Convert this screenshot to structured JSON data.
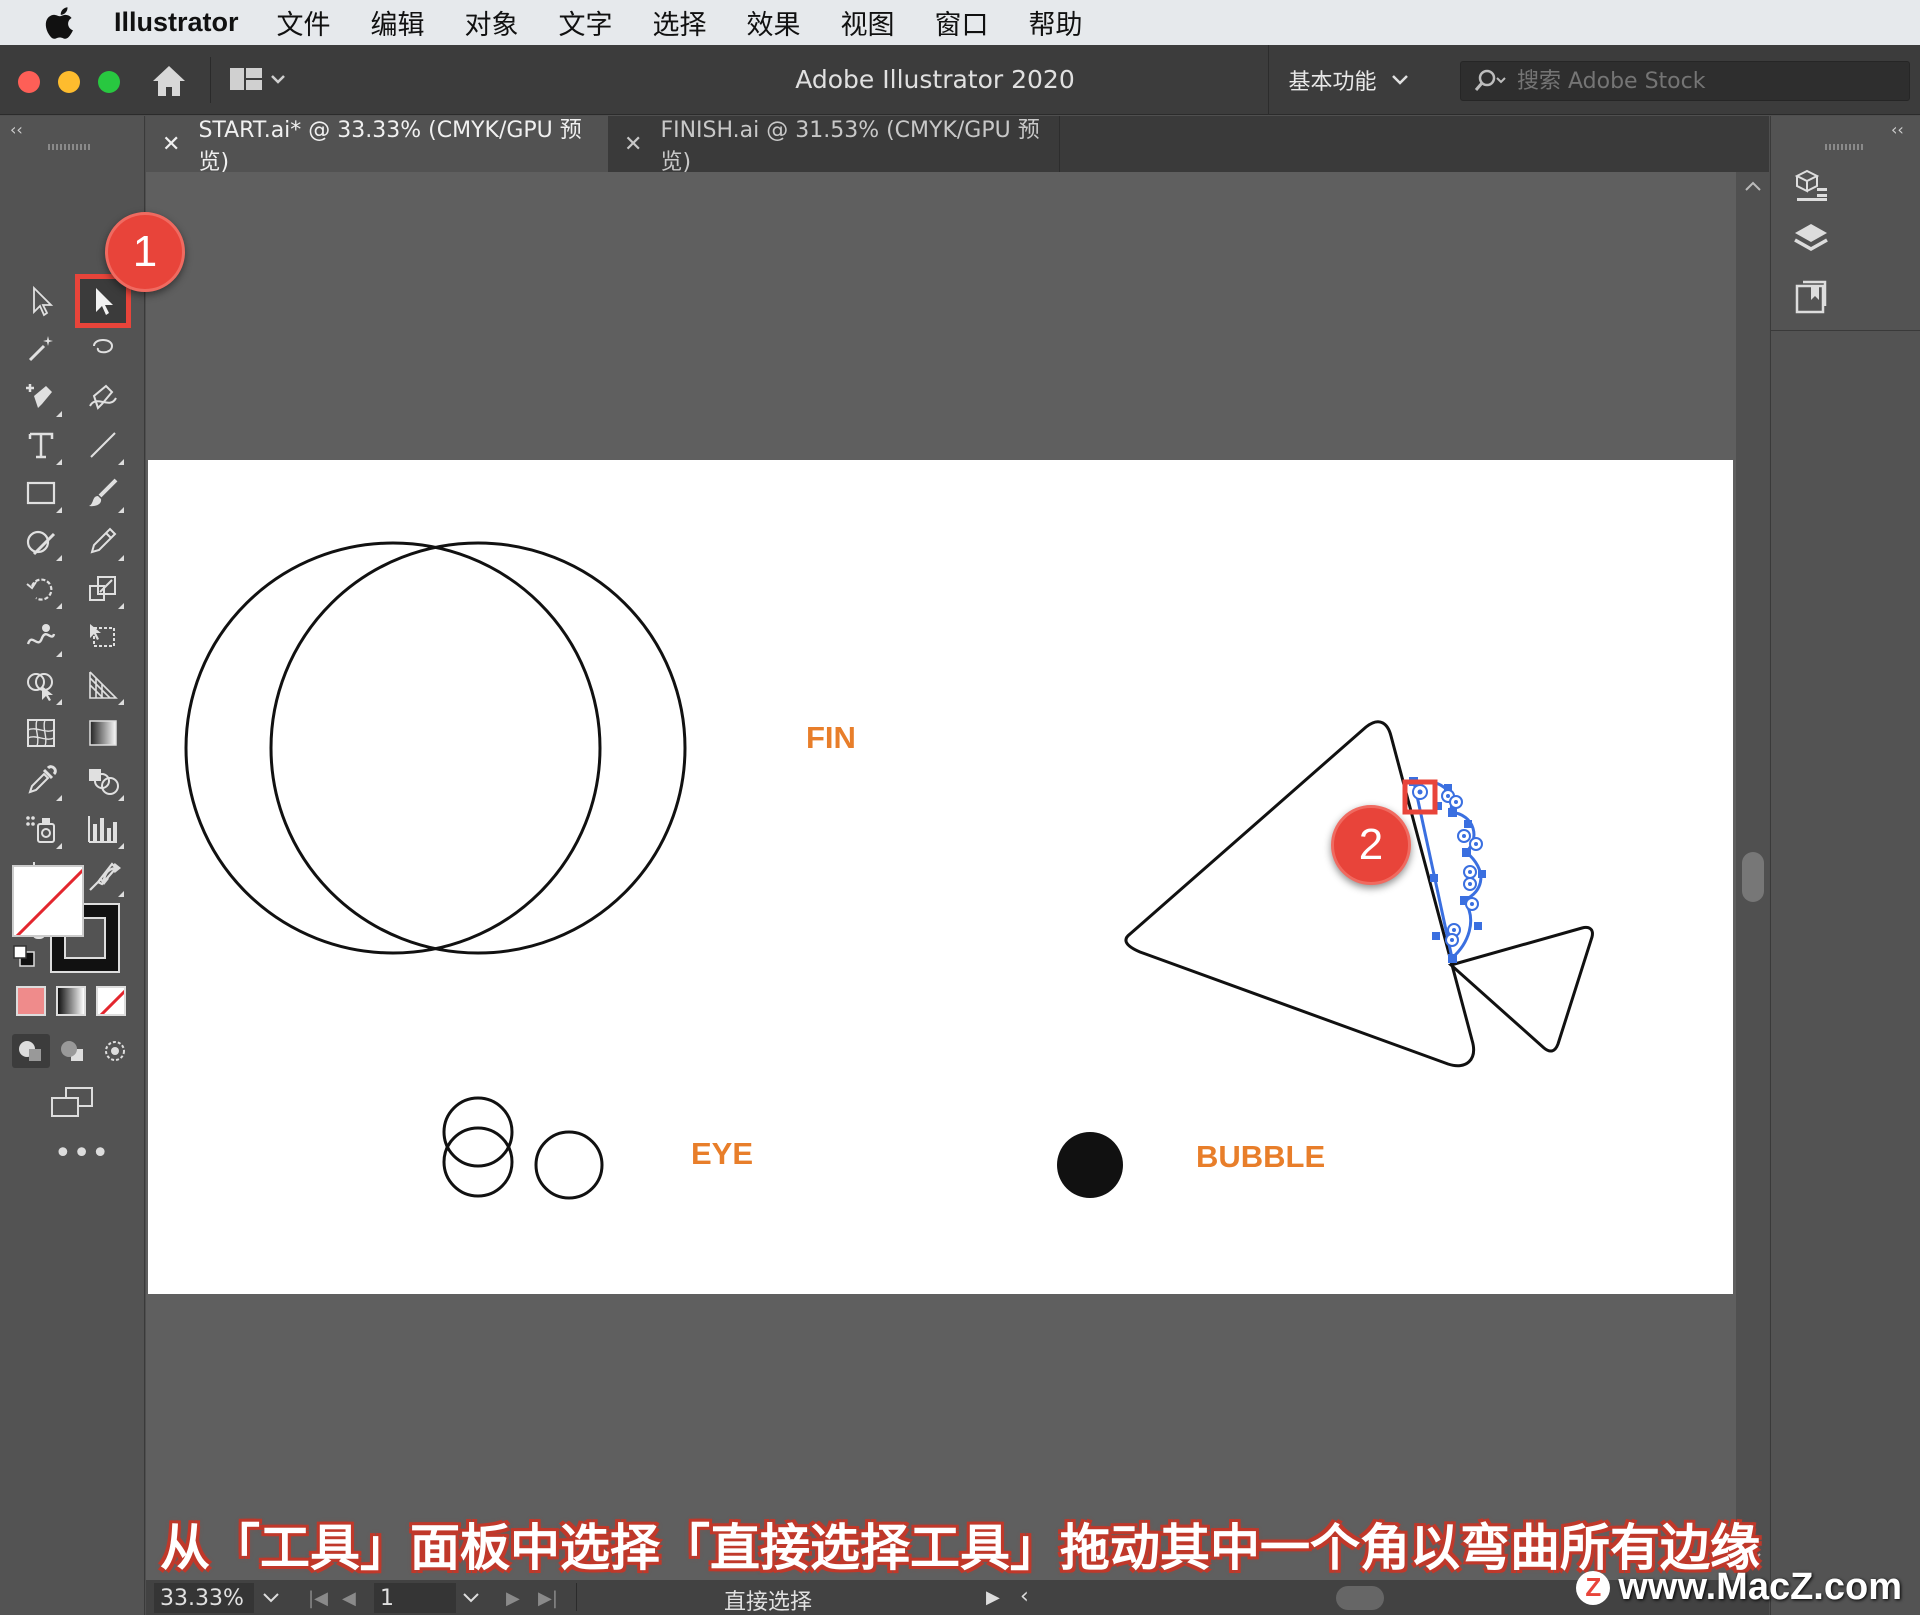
{
  "menubar": {
    "app_name": "Illustrator",
    "items": [
      "文件",
      "编辑",
      "对象",
      "文字",
      "选择",
      "效果",
      "视图",
      "窗口",
      "帮助"
    ]
  },
  "titlebar": {
    "title": "Adobe Illustrator 2020",
    "workspace": "基本功能",
    "search_placeholder": "搜索 Adobe Stock"
  },
  "tabs": [
    {
      "label": "START.ai* @ 33.33% (CMYK/GPU 预览)",
      "active": true
    },
    {
      "label": "FINISH.ai @ 31.53% (CMYK/GPU 预览)",
      "active": false
    }
  ],
  "artboard": {
    "labels": {
      "fin": "FIN",
      "eye": "EYE",
      "bubble": "BUBBLE"
    }
  },
  "statusbar": {
    "zoom": "33.33%",
    "artboard_number": "1",
    "current_tool": "直接选择"
  },
  "callouts": {
    "one": "1",
    "two": "2"
  },
  "caption": "从「工具」面板中选择「直接选择工具」拖动其中一个角以弯曲所有边缘",
  "watermark": "www.MacZ.com",
  "watermark_logo": "Z",
  "colors": {
    "label_orange": "#e87e2a",
    "callout_red": "#e8443a",
    "selection_blue": "#3a6fe0"
  }
}
